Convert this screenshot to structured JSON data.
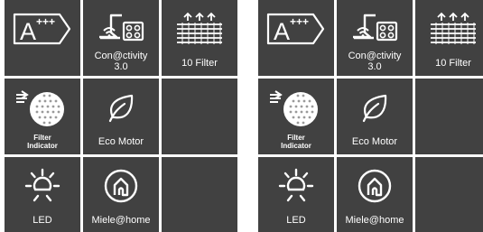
{
  "panels": [
    {
      "tiles": [
        {
          "icon": "energy-class-a-plus-plus-plus-icon",
          "badge_text": "A",
          "badge_sup": "+++",
          "label": ""
        },
        {
          "icon": "hood-hob-connectivity-icon",
          "label": "Con@ctivity\n3.0"
        },
        {
          "icon": "filter-layers-icon",
          "label": "10 Filter"
        },
        {
          "icon": "filter-indicator-icon",
          "label": "Filter\nIndicator"
        },
        {
          "icon": "eco-leaf-icon",
          "label": "Eco Motor"
        },
        {
          "icon": "",
          "label": ""
        },
        {
          "icon": "led-light-icon",
          "label": "LED"
        },
        {
          "icon": "miele-home-icon",
          "label": "Miele@home"
        },
        {
          "icon": "",
          "label": ""
        }
      ]
    },
    {
      "tiles": [
        {
          "icon": "energy-class-a-plus-plus-plus-icon",
          "badge_text": "A",
          "badge_sup": "+++",
          "label": ""
        },
        {
          "icon": "hood-hob-connectivity-icon",
          "label": "Con@ctivity\n3.0"
        },
        {
          "icon": "filter-layers-icon",
          "label": "10 Filter"
        },
        {
          "icon": "filter-indicator-icon",
          "label": "Filter\nIndicator"
        },
        {
          "icon": "eco-leaf-icon",
          "label": "Eco Motor"
        },
        {
          "icon": "",
          "label": ""
        },
        {
          "icon": "led-light-icon",
          "label": "LED"
        },
        {
          "icon": "miele-home-icon",
          "label": "Miele@home"
        },
        {
          "icon": "",
          "label": ""
        }
      ]
    }
  ],
  "colors": {
    "tile_bg": "#414141",
    "icon_fg": "#ffffff"
  }
}
